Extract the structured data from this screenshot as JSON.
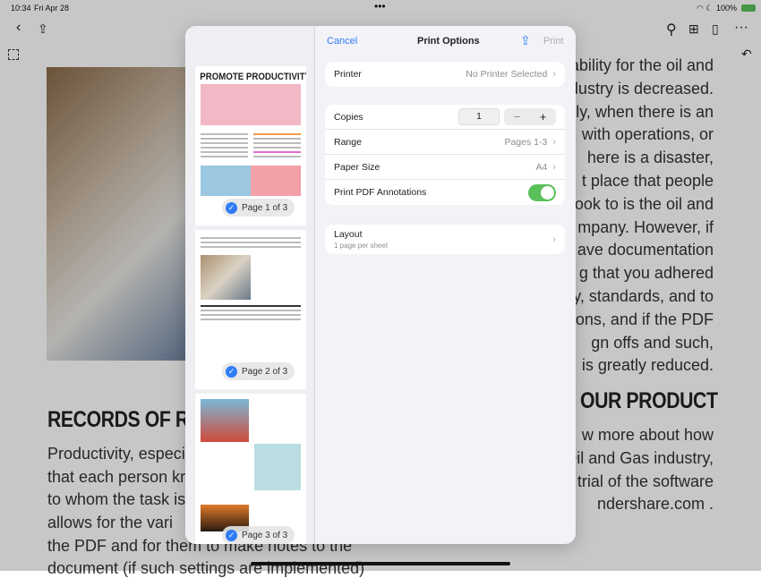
{
  "status": {
    "time": "10:34",
    "date": "Fri Apr 28",
    "battery": "100%"
  },
  "toolbar": {
    "back_icon": "chevron-left-icon",
    "share_icon": "share-icon",
    "search_icon": "search-icon",
    "grid_icon": "grid-icon",
    "page_icon": "page-icon",
    "more_icon": "ellipsis-icon",
    "select_icon": "marquee-select-icon",
    "undo_icon": "undo-icon"
  },
  "document": {
    "left_heading": "RECORDS OF RES",
    "left_lines": [
      "Productivity, especia",
      "that each person kr",
      "to whom the task is",
      "allows for the vari",
      "the PDF and for them to make notes to the",
      "document (if such settings are implemented)"
    ],
    "right_lines": [
      "hability for the oil and",
      "dustry is decreased.",
      "ly, when there is an",
      "with operations, or",
      "here is a disaster,",
      "t place that people",
      "look to is the oil and",
      "mpany. However, if",
      "ave documentation",
      "g that you adhered",
      "y, standards, and to",
      "ons, and if the PDF",
      "gn offs and such,",
      "is greatly reduced."
    ],
    "right_heading": "OUR PRODUCT",
    "right_lines2": [
      "w more about how",
      "Oil and Gas industry,",
      "n trial of the software",
      "ndershare.com ."
    ]
  },
  "print": {
    "cancel": "Cancel",
    "title": "Print Options",
    "print": "Print",
    "printer_label": "Printer",
    "printer_value": "No Printer Selected",
    "copies_label": "Copies",
    "copies_value": "1",
    "minus": "−",
    "plus": "+",
    "range_label": "Range",
    "range_value": "Pages 1-3",
    "paper_label": "Paper Size",
    "paper_value": "A4",
    "annotations_label": "Print PDF Annotations",
    "annotations_on": true,
    "layout_label": "Layout",
    "layout_sub": "1 page per sheet",
    "accent": "#2f7cf6",
    "toggle_color": "#5ac05a"
  },
  "thumbnails": [
    {
      "label": "Page 1 of 3",
      "title": "PROMOTE PRODUCTIVITY",
      "selected": true
    },
    {
      "label": "Page 2 of 3",
      "selected": true
    },
    {
      "label": "Page 3 of 3",
      "selected": true
    }
  ]
}
